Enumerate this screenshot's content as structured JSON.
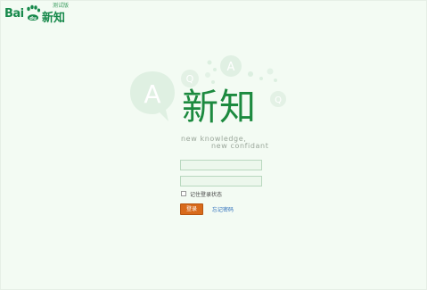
{
  "header": {
    "logo_prefix": "Bai",
    "logo_paw_text": "du",
    "logo_product": "新知",
    "logo_tag": "测试版",
    "brand_color": "#17894b"
  },
  "hero": {
    "title": "新知",
    "slogan_line1": "new  knowledge,",
    "slogan_line2": "new  confidant",
    "title_color": "#1c8a3f"
  },
  "login_form": {
    "username_value": "",
    "password_value": "",
    "remember_label": "记住登录状态",
    "remember_checked": false,
    "login_button_label": "登录",
    "forgot_link_label": "忘记密码",
    "accent_color": "#d86a1b"
  }
}
